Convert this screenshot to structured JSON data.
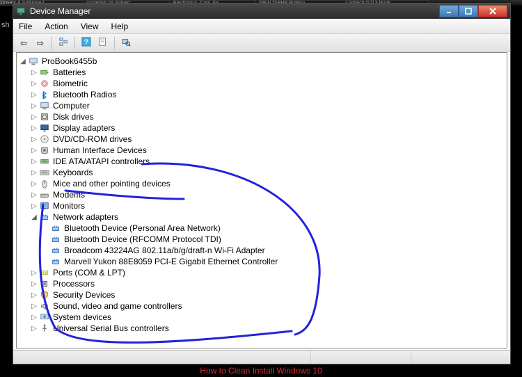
{
  "backdrop": {
    "sh": "sh",
    "bottom_link": "How to Clean Install Windows 10"
  },
  "taskbar": {
    "items": [
      "Drivers & Software f...",
      "sicdetails.txt Solved",
      "Electronics, Cars, Fa...",
      "NEW ToPHP ProBoo...",
      "Logitech G213 Prodi..."
    ]
  },
  "window": {
    "title": "Device Manager",
    "menu": {
      "file": "File",
      "action": "Action",
      "view": "View",
      "help": "Help"
    },
    "root": "ProBook6455b",
    "categories": [
      {
        "label": "Batteries",
        "icon": "battery",
        "expanded": false
      },
      {
        "label": "Biometric",
        "icon": "biometric",
        "expanded": false
      },
      {
        "label": "Bluetooth Radios",
        "icon": "bluetooth",
        "expanded": false
      },
      {
        "label": "Computer",
        "icon": "computer",
        "expanded": false
      },
      {
        "label": "Disk drives",
        "icon": "disk",
        "expanded": false
      },
      {
        "label": "Display adapters",
        "icon": "display",
        "expanded": false
      },
      {
        "label": "DVD/CD-ROM drives",
        "icon": "cdrom",
        "expanded": false
      },
      {
        "label": "Human Interface Devices",
        "icon": "hid",
        "expanded": false
      },
      {
        "label": "IDE ATA/ATAPI controllers",
        "icon": "ide",
        "expanded": false
      },
      {
        "label": "Keyboards",
        "icon": "keyboard",
        "expanded": false
      },
      {
        "label": "Mice and other pointing devices",
        "icon": "mouse",
        "expanded": false
      },
      {
        "label": "Modems",
        "icon": "modem",
        "expanded": false
      },
      {
        "label": "Monitors",
        "icon": "monitor",
        "expanded": false
      },
      {
        "label": "Network adapters",
        "icon": "network",
        "expanded": true,
        "children": [
          "Bluetooth Device (Personal Area Network)",
          "Bluetooth Device (RFCOMM Protocol TDI)",
          "Broadcom 43224AG 802.11a/b/g/draft-n Wi-Fi Adapter",
          "Marvell Yukon 88E8059 PCI-E Gigabit Ethernet Controller"
        ]
      },
      {
        "label": "Ports (COM & LPT)",
        "icon": "port",
        "expanded": false
      },
      {
        "label": "Processors",
        "icon": "cpu",
        "expanded": false
      },
      {
        "label": "Security Devices",
        "icon": "security",
        "expanded": false
      },
      {
        "label": "Sound, video and game controllers",
        "icon": "sound",
        "expanded": false
      },
      {
        "label": "System devices",
        "icon": "system",
        "expanded": false
      },
      {
        "label": "Universal Serial Bus controllers",
        "icon": "usb",
        "expanded": false
      }
    ]
  }
}
